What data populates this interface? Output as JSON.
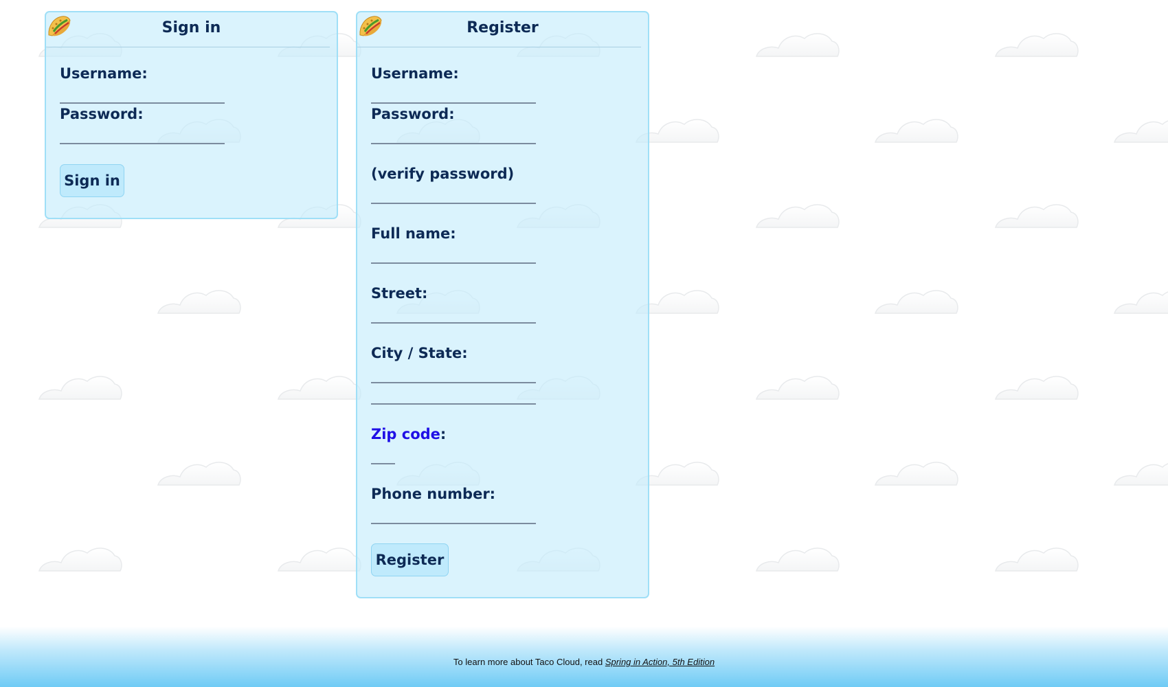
{
  "signin": {
    "title": "Sign in",
    "fields": {
      "username": "Username:",
      "password": "Password:"
    },
    "button": "Sign in"
  },
  "register": {
    "title": "Register",
    "fields": {
      "username": "Username:",
      "password": "Password:",
      "verify": "(verify password)",
      "fullname": "Full name:",
      "street": "Street:",
      "city_state": "City / State:",
      "zip_label": "Zip code",
      "zip_colon": ":",
      "phone": "Phone number:"
    },
    "button": "Register"
  },
  "footer": {
    "text": "To learn more about Taco Cloud, read",
    "link": "Spring in Action, 5th Edition"
  },
  "icons": {
    "logo": "taco-icon",
    "background": "cloud-icon"
  },
  "colors": {
    "panel": "#c4ecfc",
    "panel_border": "#9fdff7",
    "text": "#0d2a55",
    "zip_label": "#1f0fe6",
    "footer": "#6fcbf5"
  }
}
